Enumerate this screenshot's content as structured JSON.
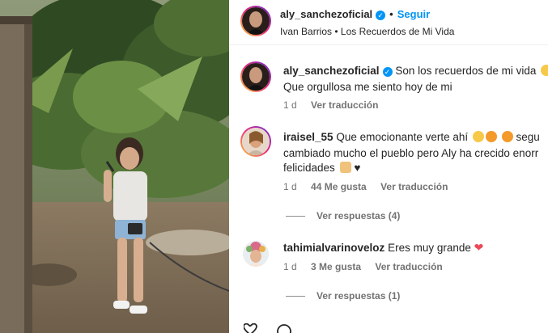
{
  "header": {
    "username": "aly_sanchezoficial",
    "follow_label": "Seguir",
    "separator": "•",
    "audio_artist": "Ivan Barrios",
    "audio_title": "Los Recuerdos de Mi Vida"
  },
  "caption": {
    "username": "aly_sanchezoficial",
    "line1": "Son los recuerdos de mi vida",
    "line2": "Que orgullosa me siento hoy de mi",
    "time": "1 d",
    "translate": "Ver traducción"
  },
  "comments": [
    {
      "username": "iraisel_55",
      "line1": "Que emocionante verte ahí",
      "line1_tail": "segu",
      "line2": "cambiado mucho el pueblo pero Aly ha crecido enorr",
      "line3": "felicidades",
      "time": "1 d",
      "likes": "44 Me gusta",
      "translate": "Ver traducción",
      "replies": "Ver respuestas (4)"
    },
    {
      "username": "tahimialvarinoveloz",
      "line1": "Eres muy grande",
      "time": "1 d",
      "likes": "3 Me gusta",
      "translate": "Ver traducción",
      "replies": "Ver respuestas (1)"
    }
  ],
  "colors": {
    "accent": "#0095f6",
    "muted": "#737373",
    "heart": "#ed4956"
  }
}
